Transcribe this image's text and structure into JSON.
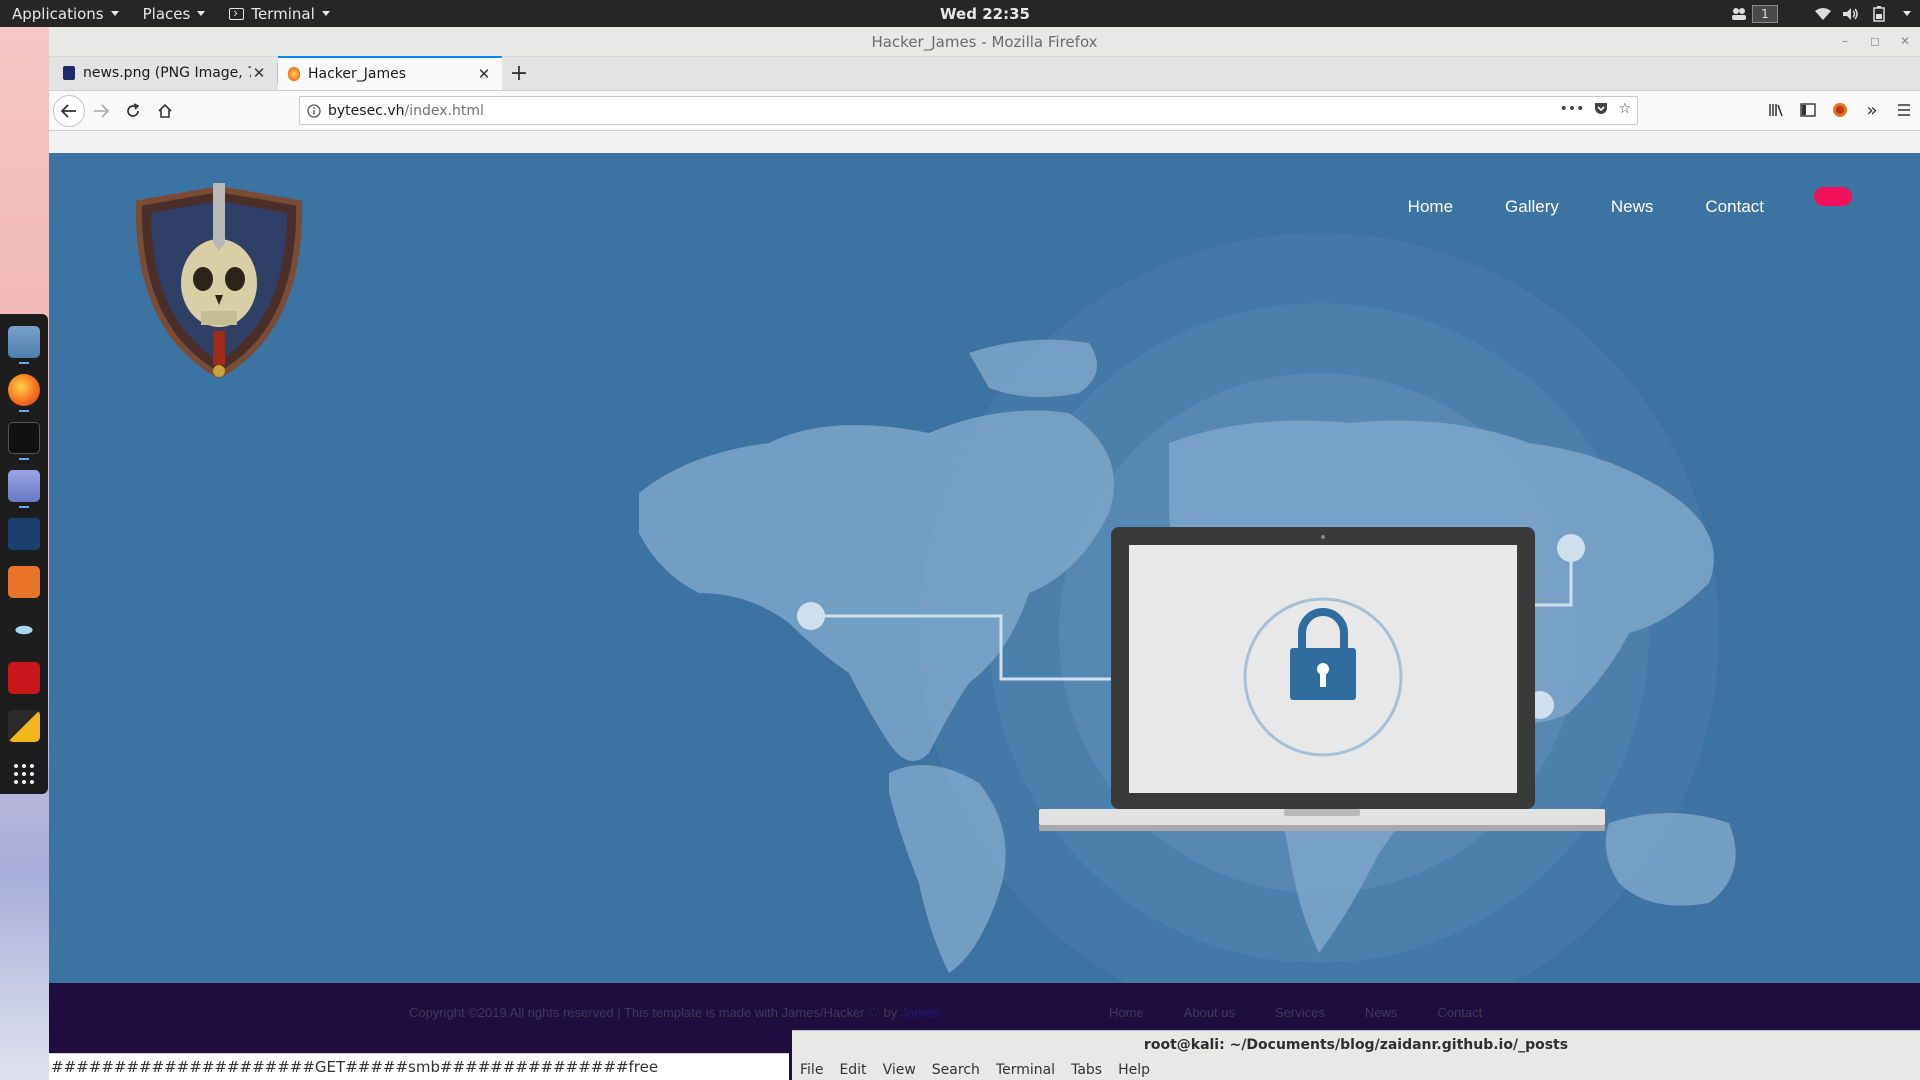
{
  "topbar": {
    "applications": "Applications",
    "places": "Places",
    "terminal": "Terminal",
    "clock": "Wed 22:35",
    "workspace": "1",
    "tray_icons": [
      "people-icon",
      "wifi-icon",
      "volume-icon",
      "battery-icon",
      "power-caret-icon"
    ]
  },
  "dock": {
    "apps": [
      "files-icon",
      "firefox-icon",
      "terminal-icon",
      "text-editor-icon",
      "metasploit-icon",
      "burpsuite-icon",
      "eye-icon",
      "cherrytree-icon",
      "pencil-icon",
      "show-apps-icon"
    ]
  },
  "browser": {
    "window_title": "Hacker_James - Mozilla Firefox",
    "tabs": [
      {
        "label": "news.png (PNG Image, 7",
        "active": false
      },
      {
        "label": "Hacker_James",
        "active": true
      }
    ],
    "url_host": "bytesec.vh",
    "url_path": "/index.html"
  },
  "site": {
    "nav": [
      "Home",
      "Gallery",
      "News",
      "Contact"
    ],
    "footer_copy": "Copyright ©2019 All rights reserved | This template is made with James/Hacker ♡ by",
    "footer_by": "James",
    "footer_links": [
      "Home",
      "About us",
      "Services",
      "News",
      "Contact"
    ]
  },
  "status_text": "#####################GET#####smb###############free",
  "terminal": {
    "title": "root@kali: ~/Documents/blog/zaidanr.github.io/_posts",
    "menu": [
      "File",
      "Edit",
      "View",
      "Search",
      "Terminal",
      "Tabs",
      "Help"
    ]
  },
  "colors": {
    "hero_bg": "#3b73a3",
    "footer_bg": "#1f0d3d",
    "accent_pink": "#f0115a",
    "tab_accent": "#0a84ff"
  }
}
